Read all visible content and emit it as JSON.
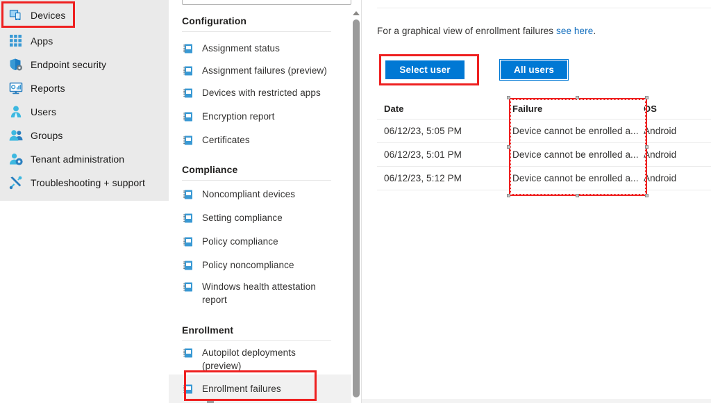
{
  "sidebar": {
    "items": [
      {
        "label": "Devices",
        "icon": "devices-icon",
        "selected": true
      },
      {
        "label": "Apps",
        "icon": "apps-grid-icon",
        "selected": false
      },
      {
        "label": "Endpoint security",
        "icon": "shield-gear-icon",
        "selected": false
      },
      {
        "label": "Reports",
        "icon": "monitor-chart-icon",
        "selected": false
      },
      {
        "label": "Users",
        "icon": "user-icon",
        "selected": false
      },
      {
        "label": "Groups",
        "icon": "users-group-icon",
        "selected": false
      },
      {
        "label": "Tenant administration",
        "icon": "user-gear-icon",
        "selected": false
      },
      {
        "label": "Troubleshooting + support",
        "icon": "wrench-screwdriver-icon",
        "selected": false
      }
    ]
  },
  "middle_panel": {
    "search_placeholder": "",
    "groups": [
      {
        "title": "Configuration",
        "items": [
          {
            "label": "Assignment status",
            "icon": "report-icon",
            "selected": false
          },
          {
            "label": "Assignment failures (preview)",
            "icon": "report-icon",
            "selected": false
          },
          {
            "label": "Devices with restricted apps",
            "icon": "report-icon",
            "selected": false
          },
          {
            "label": "Encryption report",
            "icon": "report-icon",
            "selected": false
          },
          {
            "label": "Certificates",
            "icon": "report-icon",
            "selected": false
          }
        ]
      },
      {
        "title": "Compliance",
        "items": [
          {
            "label": "Noncompliant devices",
            "icon": "report-icon",
            "selected": false
          },
          {
            "label": "Setting compliance",
            "icon": "report-icon",
            "selected": false
          },
          {
            "label": "Policy compliance",
            "icon": "report-icon",
            "selected": false
          },
          {
            "label": "Policy noncompliance",
            "icon": "report-icon",
            "selected": false
          },
          {
            "label": "Windows health attestation report",
            "icon": "report-icon",
            "selected": false
          }
        ]
      },
      {
        "title": "Enrollment",
        "items": [
          {
            "label": "Autopilot deployments (preview)",
            "icon": "report-icon",
            "selected": false
          },
          {
            "label": "Enrollment failures",
            "icon": "report-icon",
            "selected": true
          }
        ]
      }
    ]
  },
  "main": {
    "intro_prefix": "For a graphical view of enrollment failures ",
    "intro_link": "see here",
    "intro_suffix": ".",
    "select_user_label": "Select user",
    "all_users_label": "All users",
    "table": {
      "columns": [
        "Date",
        "Failure",
        "OS"
      ],
      "rows": [
        {
          "date": "06/12/23, 5:05 PM",
          "failure": "Device cannot be enrolled a...",
          "os": "Android"
        },
        {
          "date": "06/12/23, 5:01 PM",
          "failure": "Device cannot be enrolled a...",
          "os": "Android"
        },
        {
          "date": "06/12/23, 5:12 PM",
          "failure": "Device cannot be enrolled a...",
          "os": "Android"
        }
      ]
    }
  },
  "colors": {
    "accent_blue": "#0078d4",
    "link_blue": "#0f6cbd",
    "annotation_red": "#ee2020",
    "sidebar_bg": "#eaeaea",
    "selected_row_bg": "#f1f1f1"
  }
}
